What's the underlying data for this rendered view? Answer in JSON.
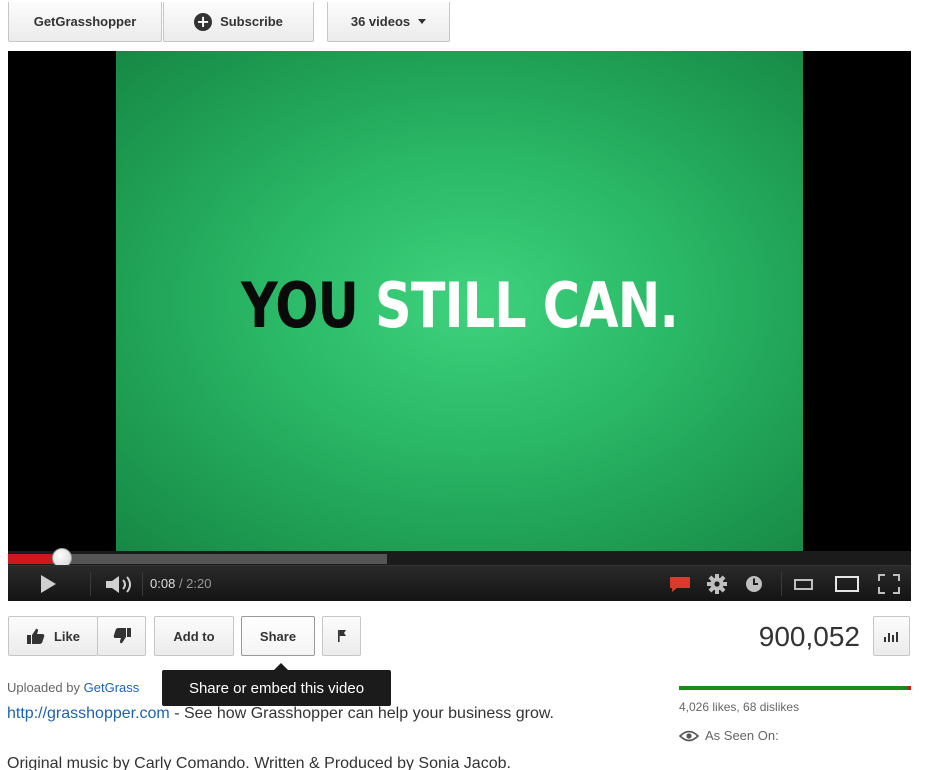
{
  "channel_bar": {
    "channel_name": "GetGrasshopper",
    "subscribe_label": "Subscribe",
    "videos_label": "36 videos"
  },
  "player": {
    "headline_word_1": "YOU",
    "headline_word_2": "STILL CAN.",
    "current_time": "0:08",
    "duration": "/ 2:20",
    "played_fraction": 0.06,
    "loaded_fraction": 0.42
  },
  "actions": {
    "like_label": "Like",
    "add_to_label": "Add to",
    "share_label": "Share",
    "view_count": "900,052"
  },
  "tooltip": {
    "text": "Share or embed this video"
  },
  "description": {
    "uploaded_prefix": "Uploaded by",
    "uploaded_link": "GetGrass",
    "url_link": "http://grasshopper.com",
    "url_suffix": " - See how Grasshopper can help your business grow.",
    "credits": "Original music by Carly Comando. Written & Produced by Sonia Jacob."
  },
  "stats": {
    "likes_dislikes": "4,026 likes, 68 dislikes",
    "like_fraction": 0.983,
    "as_seen_on": "As Seen On:"
  },
  "colors": {
    "progress_red": "#cc181e",
    "link_blue": "#1c62b9",
    "like_green": "#1a8a1a",
    "video_green": "#2bba68"
  }
}
